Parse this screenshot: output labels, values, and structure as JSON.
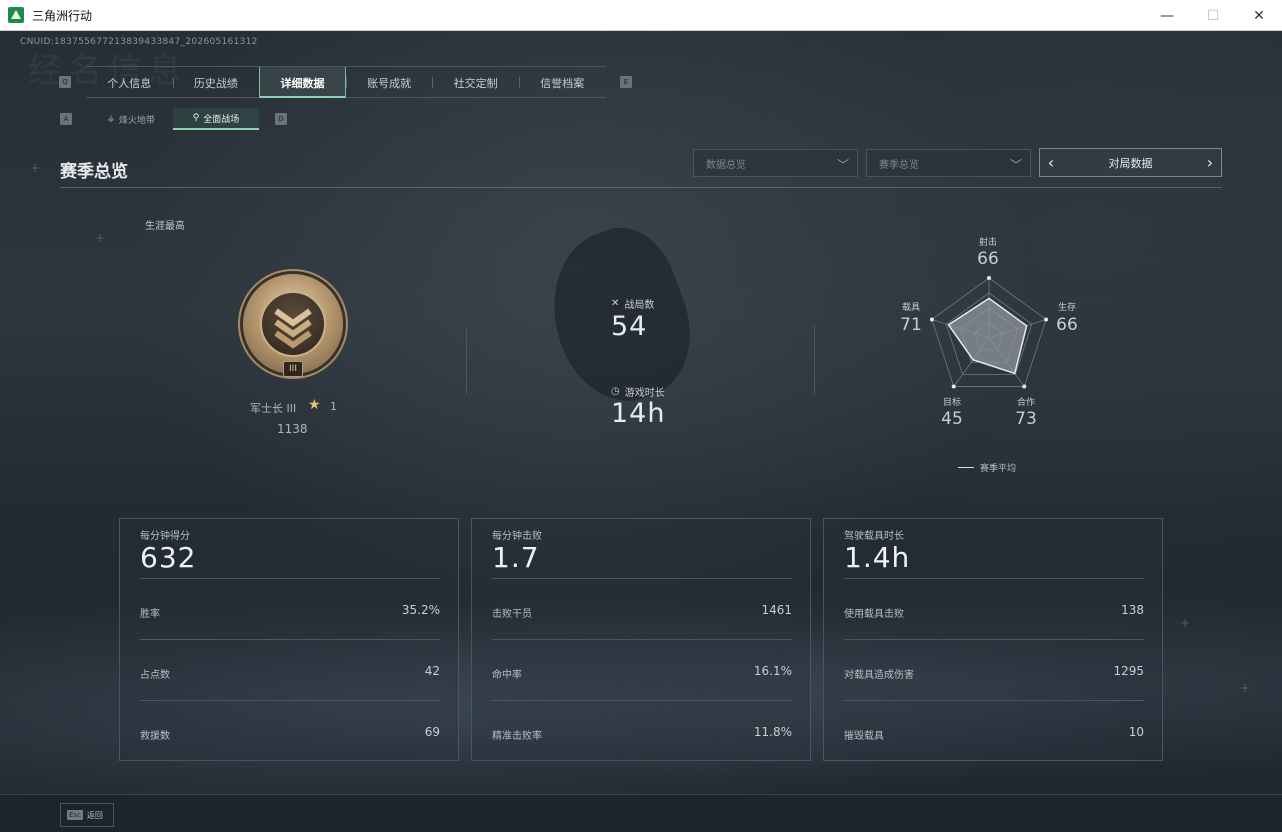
{
  "window": {
    "title": "三角洲行动",
    "controls": {
      "minimize": "—",
      "maximize": "☐",
      "close": "✕"
    }
  },
  "header": {
    "cnuid": "CNUID:183755677213839433847_202605161312",
    "bg_text": "经名信息"
  },
  "main_tabs": {
    "left_key": "Q",
    "right_key": "E",
    "items": [
      {
        "label": "个人信息",
        "active": false
      },
      {
        "label": "历史战绩",
        "active": false
      },
      {
        "label": "详细数据",
        "active": true
      },
      {
        "label": "账号成就",
        "active": false
      },
      {
        "label": "社交定制",
        "active": false
      },
      {
        "label": "信誉档案",
        "active": false
      }
    ]
  },
  "sub_tabs": {
    "left_key": "A",
    "right_key": "D",
    "items": [
      {
        "label": "烽火地带",
        "active": false
      },
      {
        "label": "全面战场",
        "active": true
      }
    ]
  },
  "section": {
    "title": "赛季总览",
    "dropdown1": "数据总览",
    "dropdown2": "赛季总览",
    "pager_label": "对局数据"
  },
  "career": {
    "label": "生涯最高",
    "rank_roman": "III",
    "rank_name": "军士长 III",
    "stars": "1",
    "score": "1138"
  },
  "summary": {
    "matches_label": "战局数",
    "matches_value": "54",
    "playtime_label": "游戏时长",
    "playtime_value": "14h"
  },
  "radar": {
    "axes": [
      {
        "label": "射击",
        "value": "66"
      },
      {
        "label": "生存",
        "value": "66"
      },
      {
        "label": "合作",
        "value": "73"
      },
      {
        "label": "目标",
        "value": "45"
      },
      {
        "label": "载具",
        "value": "71"
      }
    ],
    "legend": "赛季平均",
    "fill_color": "#8f969c",
    "line_color": "#e6eaed"
  },
  "cards": [
    {
      "title": "每分钟得分",
      "big": "632",
      "rows": [
        {
          "label": "胜率",
          "value": "35.2%"
        },
        {
          "label": "占点数",
          "value": "42"
        },
        {
          "label": "救援数",
          "value": "69"
        }
      ]
    },
    {
      "title": "每分钟击败",
      "big": "1.7",
      "rows": [
        {
          "label": "击败干员",
          "value": "1461"
        },
        {
          "label": "命中率",
          "value": "16.1%"
        },
        {
          "label": "精准击败率",
          "value": "11.8%"
        }
      ]
    },
    {
      "title": "驾驶载具时长",
      "big": "1.4h",
      "rows": [
        {
          "label": "使用载具击败",
          "value": "138"
        },
        {
          "label": "对载具造成伤害",
          "value": "1295"
        },
        {
          "label": "摧毁载具",
          "value": "10"
        }
      ]
    }
  ],
  "footer": {
    "esc_key": "Esc",
    "esc_label": "返回"
  },
  "colors": {
    "accent": "#8fd0b2",
    "background": "#262e36",
    "star": "#e2c46a"
  }
}
